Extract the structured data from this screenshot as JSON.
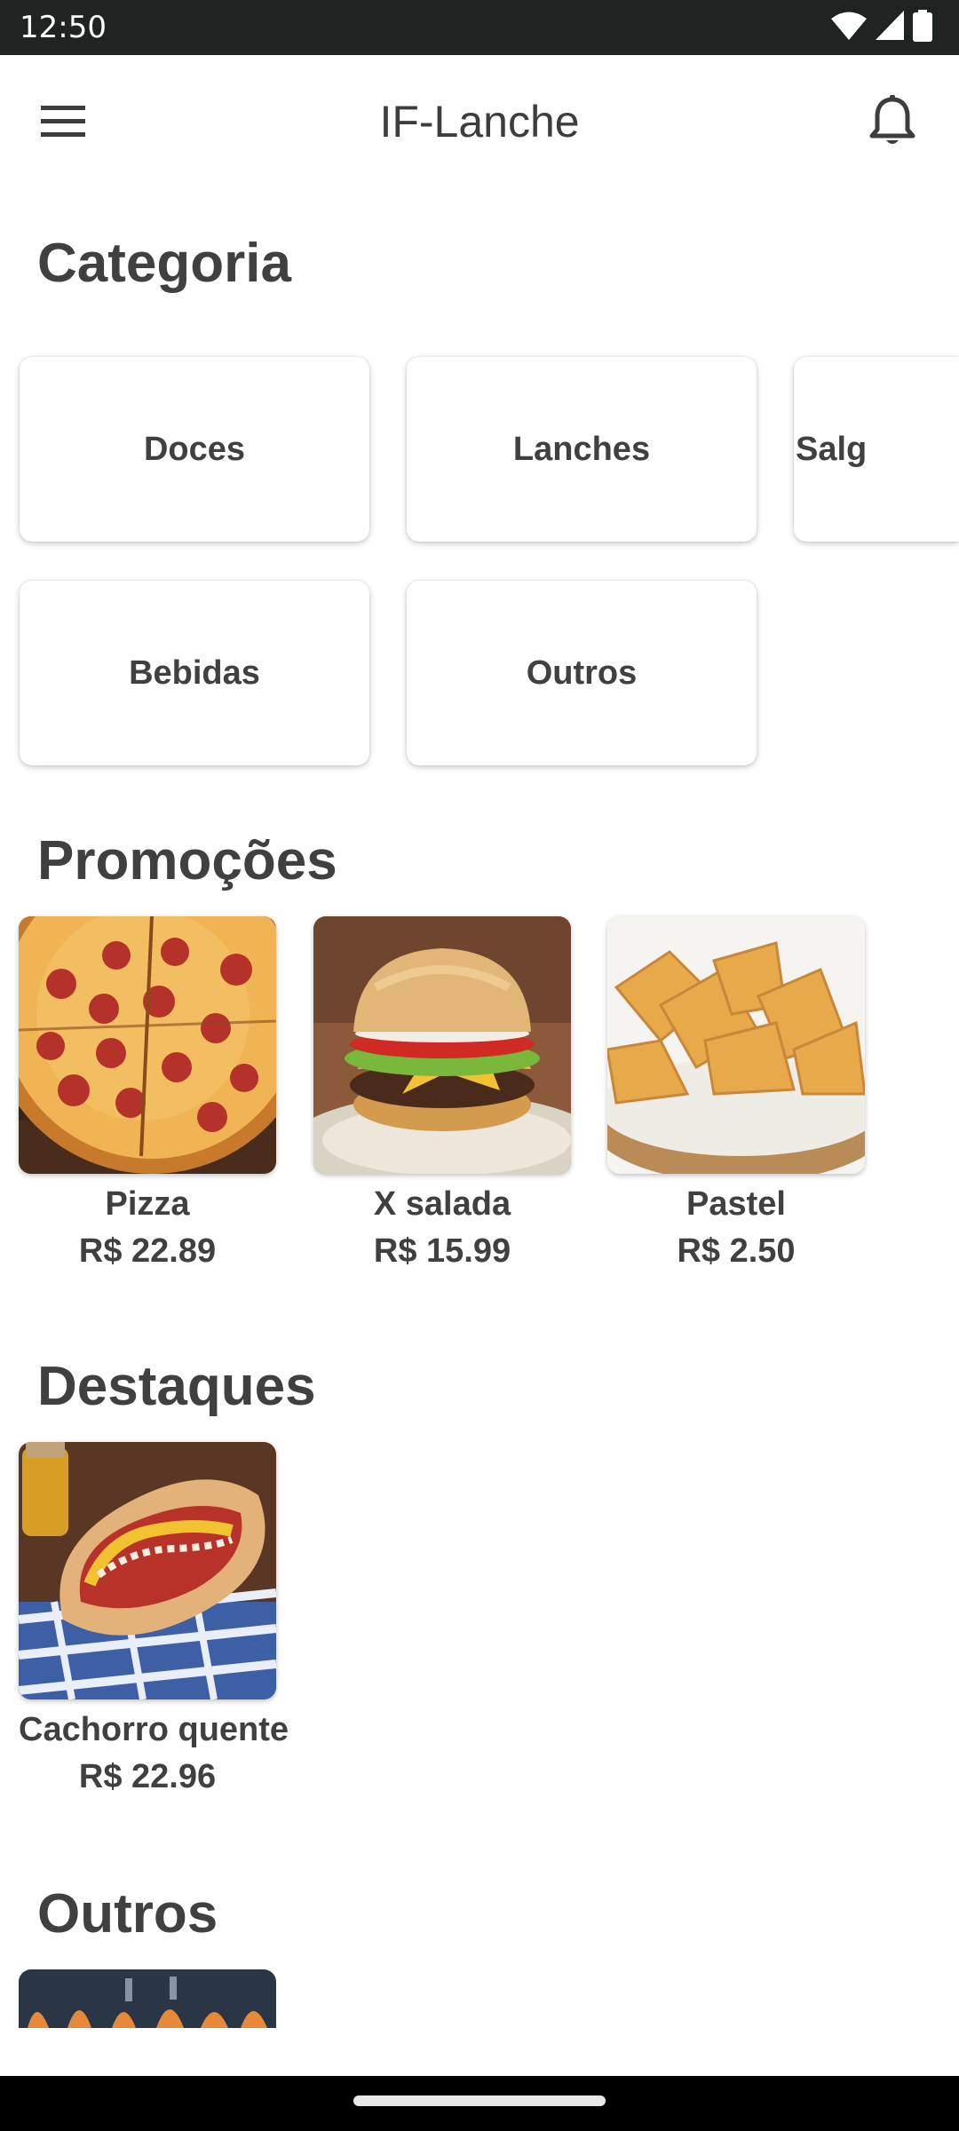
{
  "status_bar": {
    "time": "12:50",
    "icons": [
      "wifi-icon",
      "signal-icon",
      "battery-icon"
    ]
  },
  "app_bar": {
    "title": "IF-Lanche",
    "left_icon": "menu-icon",
    "right_icon": "bell-icon"
  },
  "sections": {
    "categoria": "Categoria",
    "promocoes": "Promoções",
    "destaques": "Destaques",
    "outros": "Outros"
  },
  "categories": [
    "Doces",
    "Lanches",
    "Salg",
    "Bebidas",
    "Outros"
  ],
  "promotions": [
    {
      "name": "Pizza",
      "price": "R$ 22.89"
    },
    {
      "name": "X salada",
      "price": "R$ 15.99"
    },
    {
      "name": "Pastel",
      "price": "R$ 2.50"
    }
  ],
  "highlights": [
    {
      "name": "Cachorro quente",
      "price": "R$ 22.96"
    }
  ],
  "colors": {
    "status_bar": "#1f2423",
    "text": "#404040",
    "background": "#ffffff"
  }
}
